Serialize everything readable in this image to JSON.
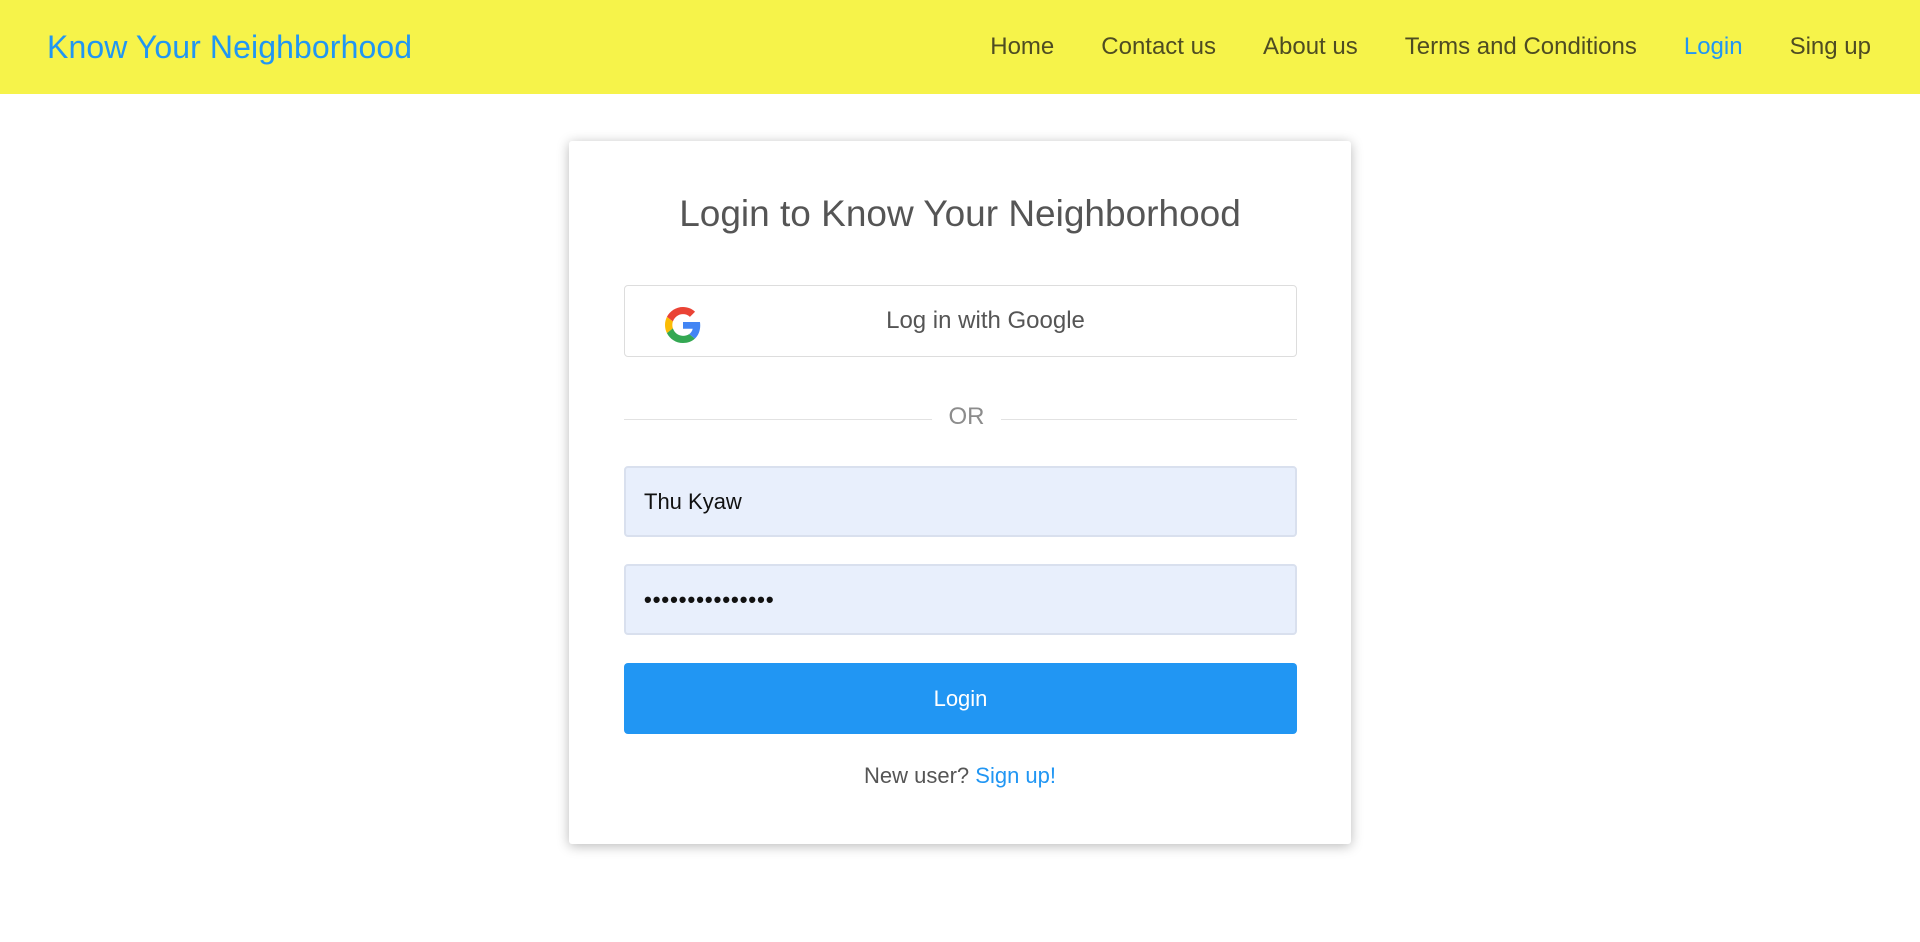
{
  "navbar": {
    "brand": "Know Your Neighborhood",
    "links": [
      {
        "label": "Home"
      },
      {
        "label": "Contact us"
      },
      {
        "label": "About us"
      },
      {
        "label": "Terms and Conditions"
      },
      {
        "label": "Login",
        "active": true
      },
      {
        "label": "Sing up"
      }
    ],
    "background_color": "#f6f34a",
    "accent_color": "#2196f3"
  },
  "login_card": {
    "title": "Login to Know Your Neighborhood",
    "google_button": {
      "label": "Log in with Google",
      "icon": "google-icon"
    },
    "divider_text": "OR",
    "username_field": {
      "value": "Thu Kyaw"
    },
    "password_field": {
      "value": "•••••••••••••••"
    },
    "login_button": {
      "label": "Login",
      "color": "#2196f3"
    },
    "footer": {
      "prompt": "New user?",
      "link_label": "Sign up!"
    }
  }
}
